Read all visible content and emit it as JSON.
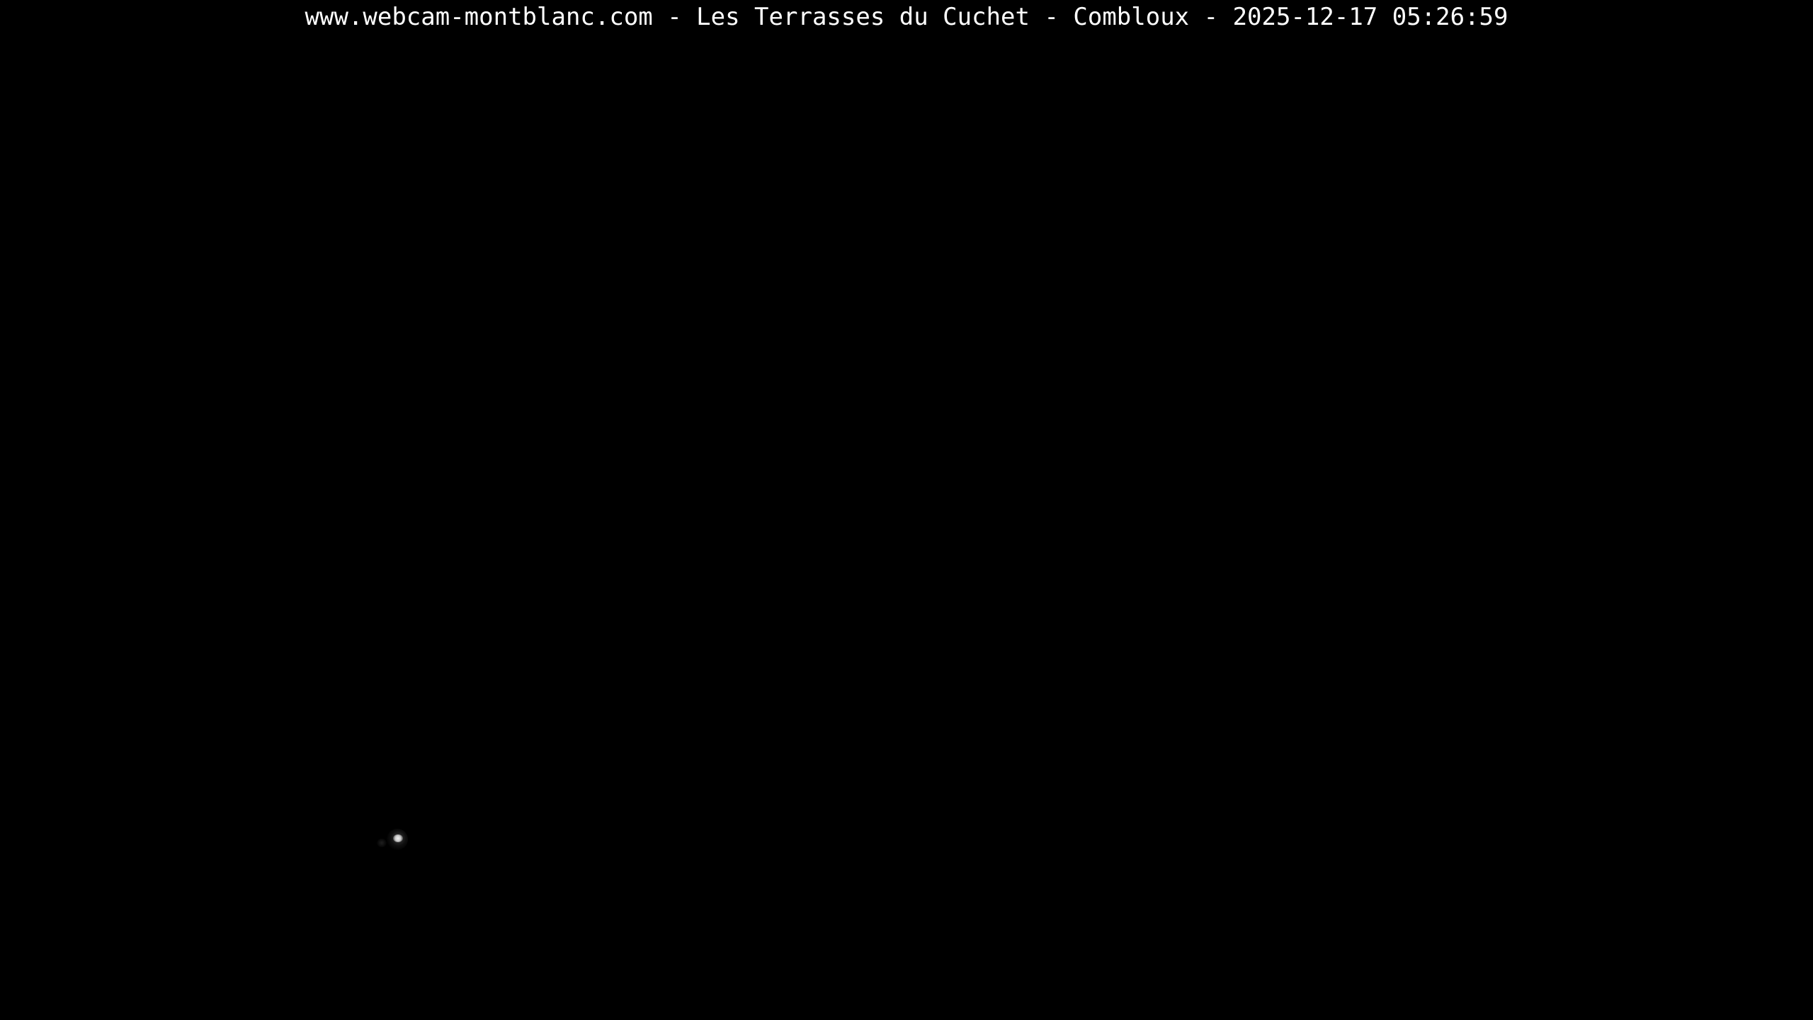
{
  "overlay": {
    "caption": "www.webcam-montblanc.com - Les Terrasses du Cuchet - Combloux - 2025-12-17 05:26:59"
  },
  "scene": {
    "background_color": "#000000",
    "text_color": "#ffffff"
  }
}
